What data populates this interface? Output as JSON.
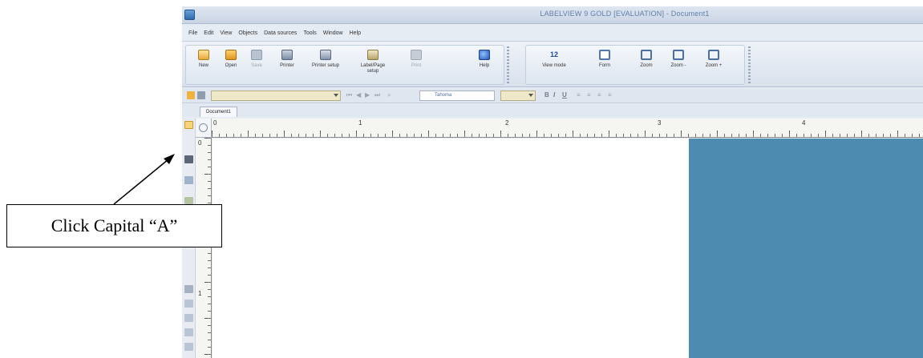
{
  "window": {
    "title": "LABELVIEW 9 GOLD [EVALUATION] - Document1"
  },
  "menu": [
    "File",
    "Edit",
    "View",
    "Objects",
    "Data sources",
    "Tools",
    "Window",
    "Help"
  ],
  "ribbon": {
    "buttons": [
      {
        "label": "New",
        "icon": "new-document-icon",
        "enabled": true
      },
      {
        "label": "Open",
        "icon": "open-folder-icon",
        "enabled": true
      },
      {
        "label": "Save",
        "icon": "save-disk-icon",
        "enabled": false
      },
      {
        "label": "Printer",
        "icon": "printer-icon",
        "enabled": true
      },
      {
        "label": "Printer setup",
        "icon": "printer-setup-icon",
        "enabled": true
      },
      {
        "label": "Label/Page setup",
        "icon": "label-page-setup-icon",
        "enabled": true
      },
      {
        "label": "Print",
        "icon": "print-icon",
        "enabled": false
      },
      {
        "label": "Help",
        "icon": "help-icon",
        "enabled": true
      }
    ],
    "view_buttons": [
      {
        "label": "View mode",
        "icon_text": "12"
      },
      {
        "label": "Form",
        "icon": "form-icon"
      },
      {
        "label": "Zoom",
        "icon": "zoom-icon"
      },
      {
        "label": "Zoom -",
        "icon": "zoom-out-icon"
      },
      {
        "label": "Zoom +",
        "icon": "zoom-in-icon"
      }
    ]
  },
  "toolbar2": {
    "font_name": "Tahoma",
    "format_glyphs": [
      "B",
      "I",
      "U"
    ]
  },
  "document_tab": "Document1",
  "rulers": {
    "horizontal_labels": [
      "0",
      "1",
      "2",
      "3",
      "4"
    ],
    "vertical_labels": [
      "0",
      "1"
    ]
  },
  "callout": {
    "text": "Click Capital “A”"
  },
  "colors": {
    "canvas_background": "#4e8bb1",
    "label_page": "#ffffff",
    "selected_tool": "#f7d37a"
  }
}
